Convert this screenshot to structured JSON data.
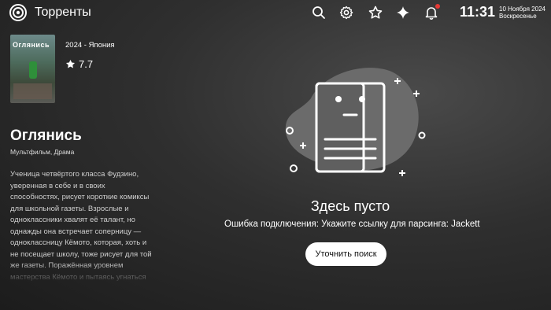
{
  "header": {
    "app_title": "Торренты",
    "icons": [
      "search-icon",
      "gear-icon",
      "star-icon",
      "sparkle-icon",
      "bell-icon"
    ],
    "clock": "11:31",
    "date": "10 Ноября 2024",
    "weekday": "Воскресенье",
    "notification_color": "#e53935"
  },
  "movie": {
    "poster_title": "Оглянись",
    "year_country": "2024 - Япония",
    "rating": "7.7",
    "title": "Оглянись",
    "genres": "Мультфильм, Драма",
    "description": "Ученица четвёртого класса Фудзино, уверенная в себе и в своих способностях, рисует короткие комиксы для школьной газеты. Взрослые и одноклассники хвалят её талант, но однажды она встречает соперницу — одноклассницу Кёмото, которая, хоть и не посещает школу, тоже рисует для той же газеты. Поражённая уровнем мастерства Кёмото и пытаясь угнаться за ней, Фудзино бросает все силы на то, чтобы научиться лучше"
  },
  "empty_state": {
    "title": "Здесь пусто",
    "message": "Ошибка подключения: Укажите ссылку для парсинга: Jackett",
    "button_label": "Уточнить поиск"
  }
}
